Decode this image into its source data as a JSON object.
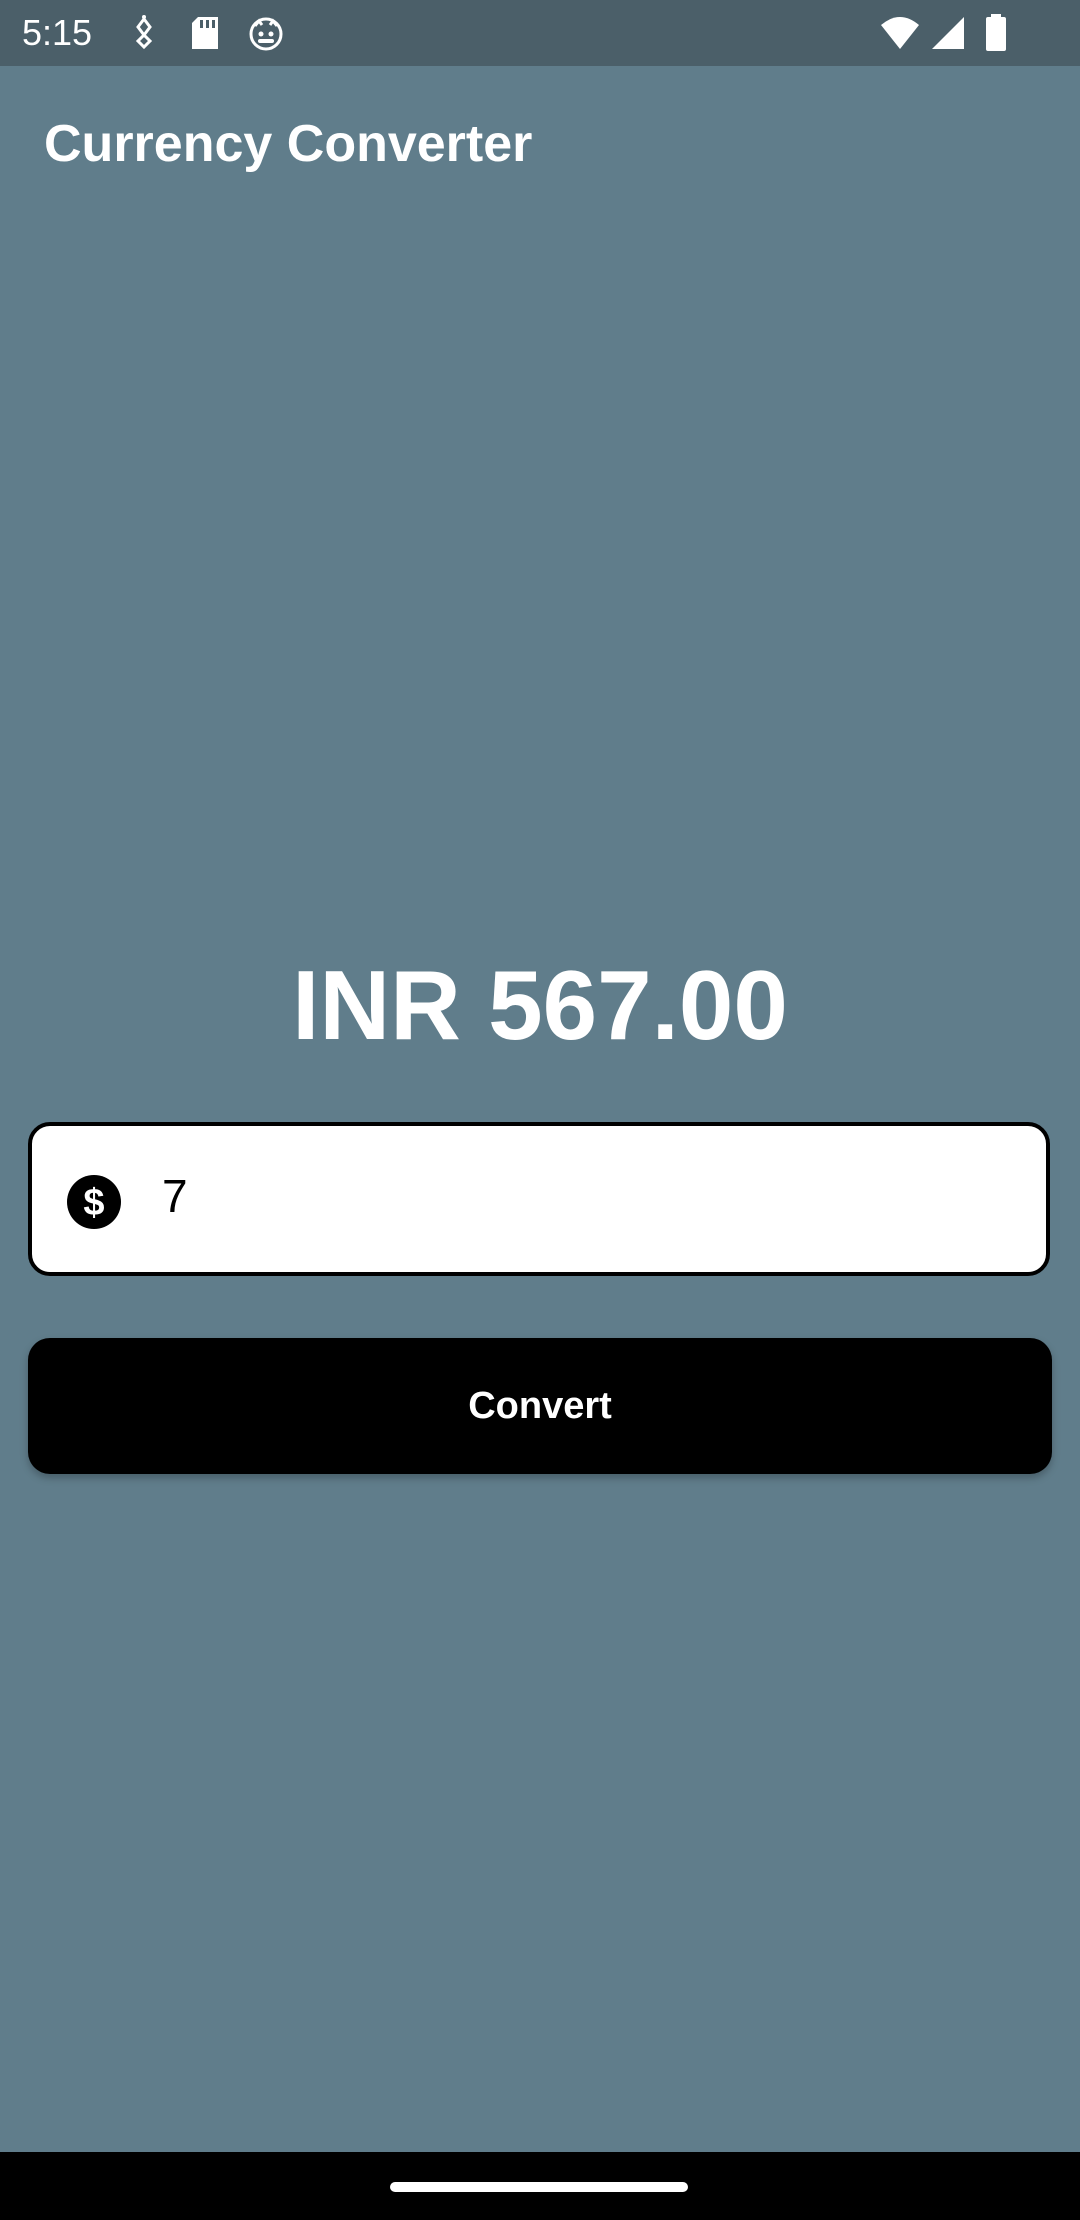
{
  "status_bar": {
    "time": "5:15",
    "icons": [
      "usb-debug-icon",
      "sd-card-icon",
      "android-icon",
      "wifi-icon",
      "signal-icon",
      "battery-icon"
    ]
  },
  "app": {
    "title": "Currency Converter",
    "background_color": "#607d8b"
  },
  "result": {
    "text": "INR 567.00"
  },
  "amount_input": {
    "icon": "dollar-icon",
    "value": "7"
  },
  "convert_button": {
    "label": "Convert"
  }
}
